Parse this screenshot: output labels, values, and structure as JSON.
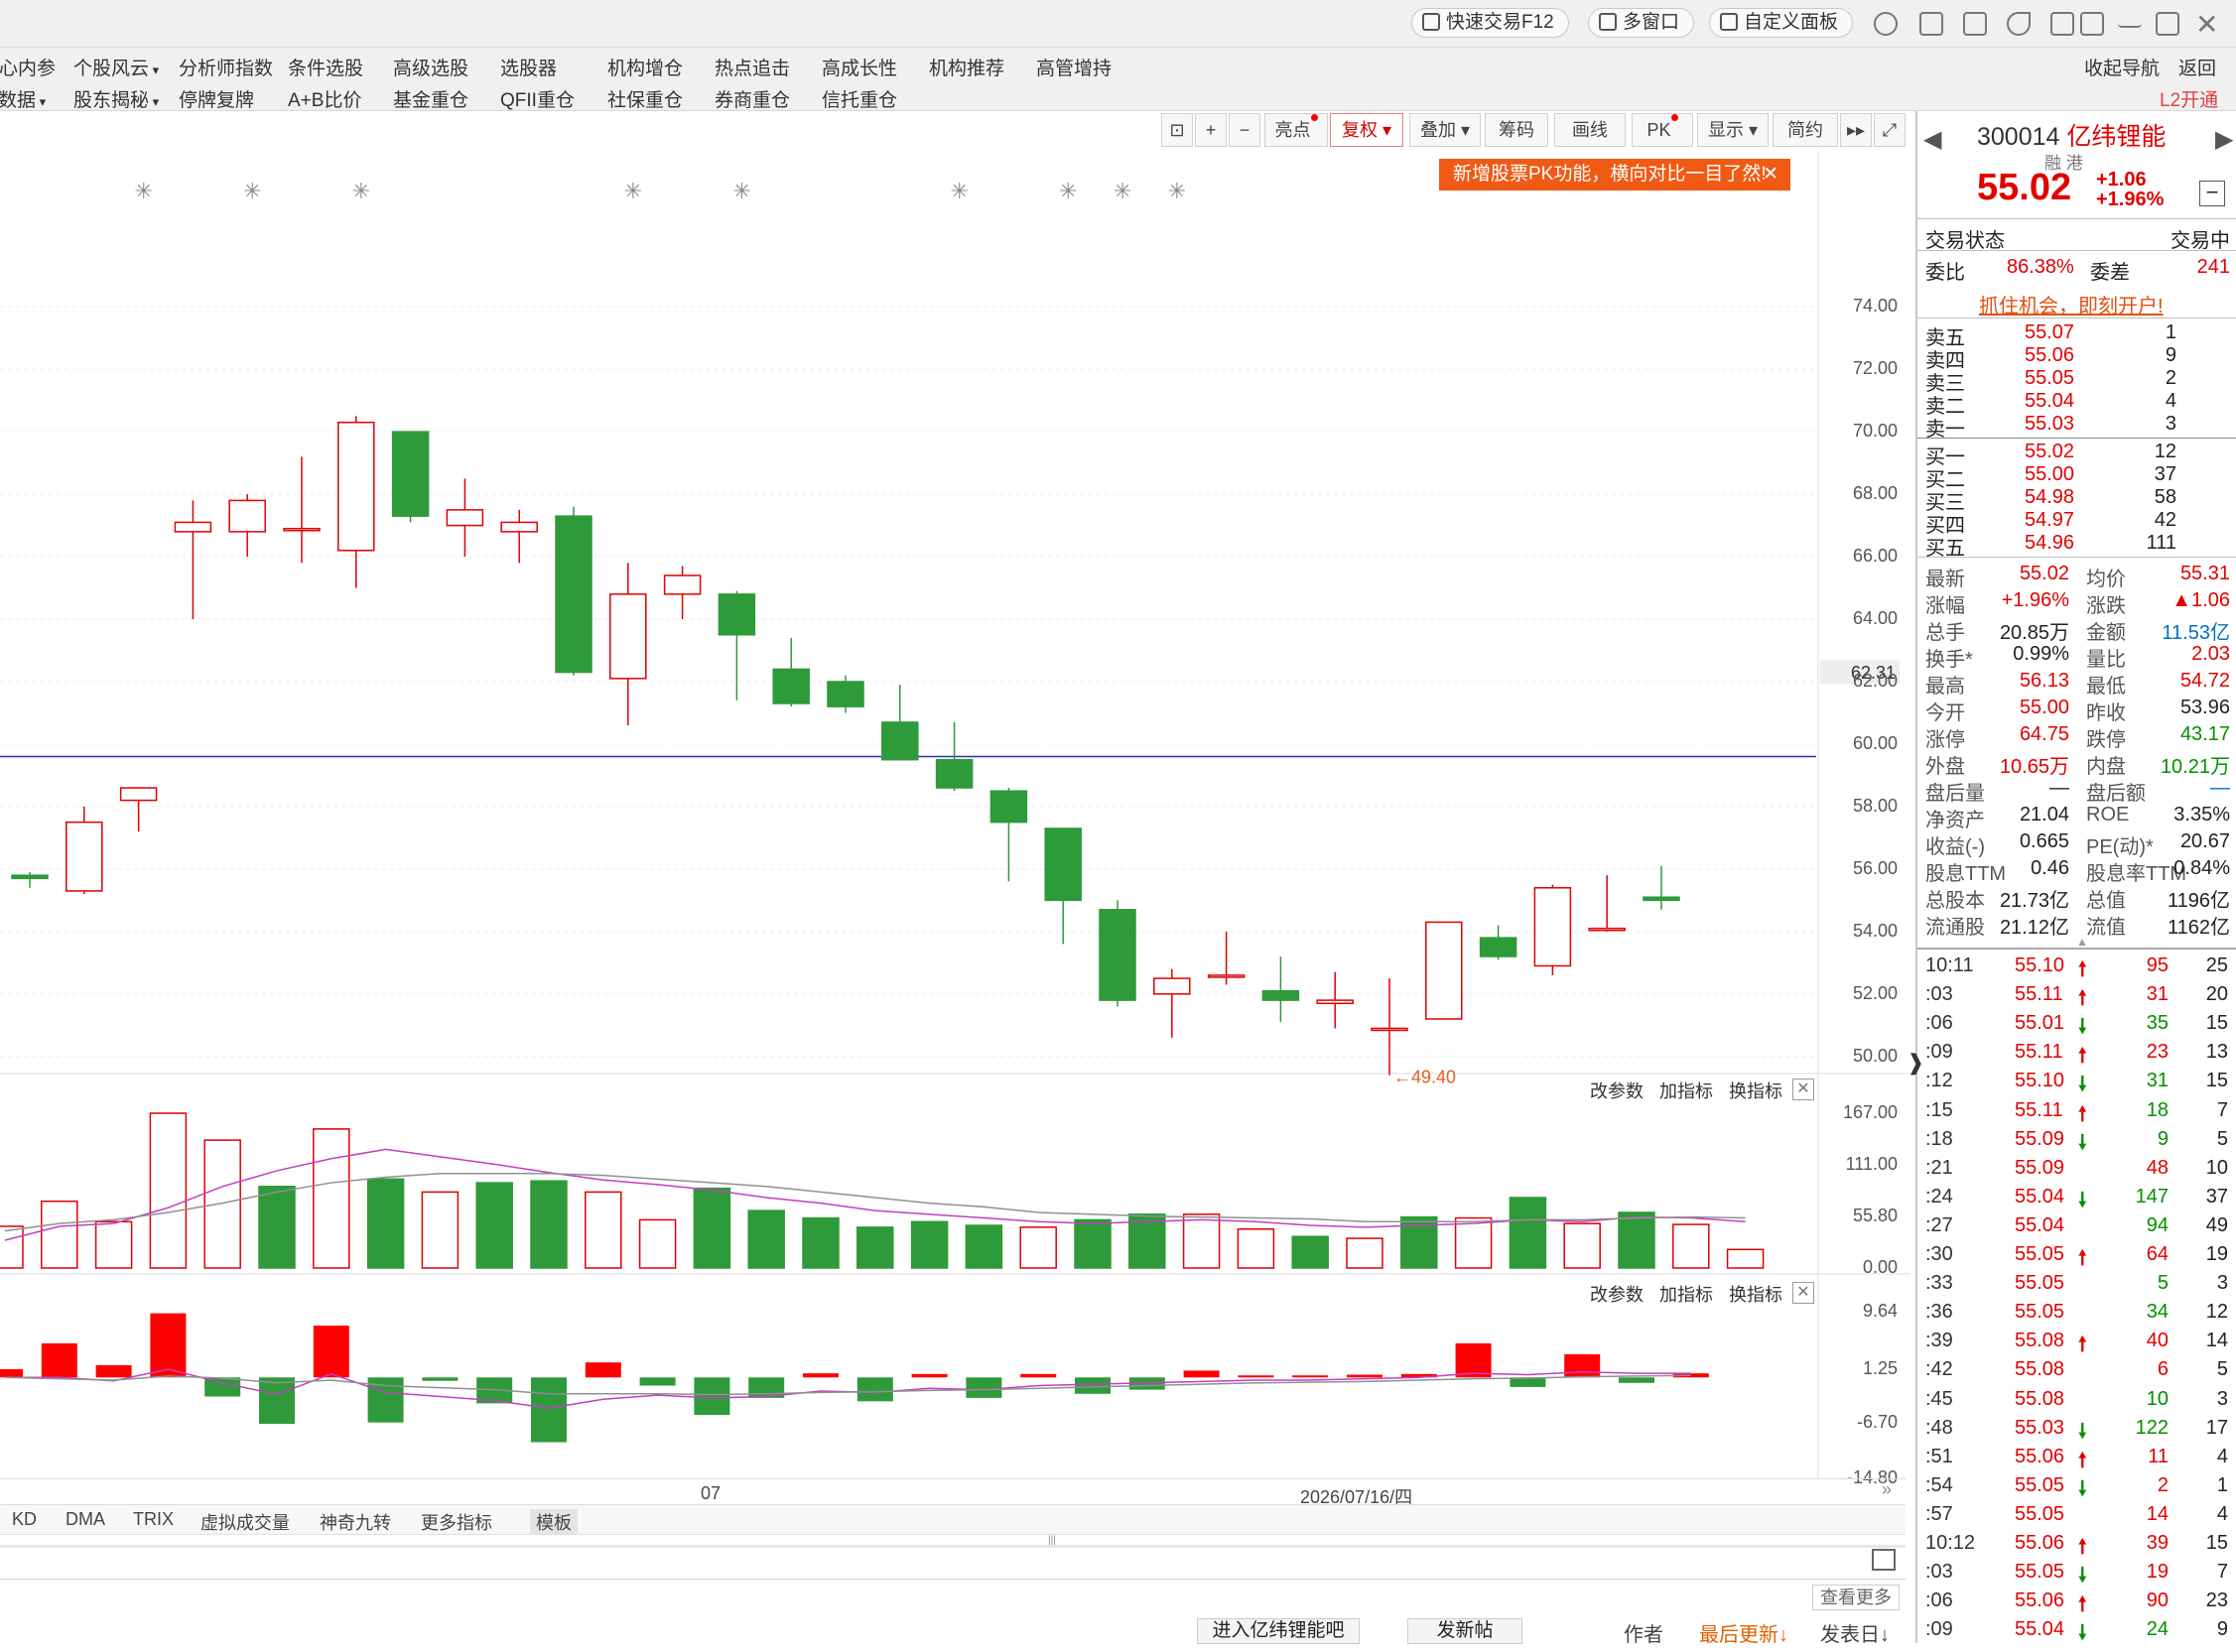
{
  "topbar": {
    "quick_trade": "快速交易F12",
    "multi_window": "多窗口",
    "custom_panel": "自定义面板",
    "icons": [
      "user-icon",
      "mail-icon",
      "home-icon",
      "back-icon",
      "shirt-icon",
      "layout-icon",
      "minimize-icon",
      "restore-icon",
      "close-icon"
    ]
  },
  "menu": {
    "row1": [
      "核心内参",
      "个股风云",
      "分析师指数",
      "条件选股",
      "高级选股",
      "选股器",
      "机构增仓",
      "热点追击",
      "高成长性",
      "机构推荐",
      "高管增持"
    ],
    "row2": [
      "数据",
      "股东揭秘",
      "停牌复牌",
      "A+B比价",
      "基金重仓",
      "QFII重仓",
      "社保重仓",
      "券商重仓",
      "信托重仓"
    ],
    "right": [
      "收起导航",
      "返回"
    ],
    "l2": "L2开通"
  },
  "chart_toolbar": {
    "buttons": [
      "亮点",
      "复权",
      "叠加",
      "筹码",
      "画线",
      "PK",
      "显示",
      "简约"
    ],
    "pk_tip": "新增股票PK功能，横向对比一目了然!"
  },
  "pane_tools": {
    "params": "改参数",
    "add": "加指标",
    "swap": "换指标"
  },
  "chart_data": [
    {
      "type": "candlestick",
      "title": "",
      "y_ticks": [
        "74.00",
        "72.00",
        "70.00",
        "68.00",
        "66.00",
        "64.00",
        "62.00",
        "60.00",
        "58.00",
        "56.00",
        "54.00",
        "52.00",
        "50.00"
      ],
      "ylim": [
        48.5,
        75.5
      ],
      "current_price_marker": "62.31",
      "horizontal_line": 59.6,
      "low_annotation": "←49.40",
      "candles": [
        {
          "o": 55.8,
          "h": 55.9,
          "l": 55.4,
          "c": 55.7
        },
        {
          "o": 55.3,
          "h": 58.0,
          "l": 55.2,
          "c": 57.5
        },
        {
          "o": 58.2,
          "h": 58.5,
          "l": 57.2,
          "c": 58.6
        },
        {
          "o": 66.8,
          "h": 67.8,
          "l": 64.0,
          "c": 67.1
        },
        {
          "o": 66.8,
          "h": 68.0,
          "l": 66.0,
          "c": 67.8
        },
        {
          "o": 66.9,
          "h": 69.2,
          "l": 65.8,
          "c": 66.9
        },
        {
          "o": 66.2,
          "h": 70.5,
          "l": 65.0,
          "c": 70.3
        },
        {
          "o": 70.0,
          "h": 70.0,
          "l": 67.1,
          "c": 67.3
        },
        {
          "o": 67.0,
          "h": 68.5,
          "l": 66.0,
          "c": 67.5
        },
        {
          "o": 66.8,
          "h": 67.5,
          "l": 65.8,
          "c": 67.1
        },
        {
          "o": 67.3,
          "h": 67.6,
          "l": 62.2,
          "c": 62.3
        },
        {
          "o": 62.1,
          "h": 65.8,
          "l": 60.6,
          "c": 64.8
        },
        {
          "o": 64.8,
          "h": 65.7,
          "l": 64.0,
          "c": 65.4
        },
        {
          "o": 64.8,
          "h": 64.9,
          "l": 61.4,
          "c": 63.5
        },
        {
          "o": 62.4,
          "h": 63.4,
          "l": 61.2,
          "c": 61.3
        },
        {
          "o": 62.0,
          "h": 62.2,
          "l": 61.0,
          "c": 61.2
        },
        {
          "o": 60.7,
          "h": 61.9,
          "l": 59.6,
          "c": 59.5
        },
        {
          "o": 59.5,
          "h": 60.7,
          "l": 58.5,
          "c": 58.6
        },
        {
          "o": 58.5,
          "h": 58.6,
          "l": 55.6,
          "c": 57.5
        },
        {
          "o": 57.3,
          "h": 57.3,
          "l": 53.6,
          "c": 55.0
        },
        {
          "o": 54.7,
          "h": 55.0,
          "l": 51.6,
          "c": 51.8
        },
        {
          "o": 52.0,
          "h": 52.8,
          "l": 50.6,
          "c": 52.5
        },
        {
          "o": 52.6,
          "h": 54.0,
          "l": 52.3,
          "c": 52.6
        },
        {
          "o": 52.1,
          "h": 53.2,
          "l": 51.1,
          "c": 51.8
        },
        {
          "o": 51.7,
          "h": 52.7,
          "l": 50.9,
          "c": 51.8
        },
        {
          "o": 50.9,
          "h": 52.5,
          "l": 49.4,
          "c": 50.9
        },
        {
          "o": 51.2,
          "h": 54.3,
          "l": 51.2,
          "c": 54.3
        },
        {
          "o": 53.8,
          "h": 54.2,
          "l": 53.1,
          "c": 53.2
        },
        {
          "o": 52.9,
          "h": 55.5,
          "l": 52.6,
          "c": 55.4
        },
        {
          "o": 54.1,
          "h": 55.8,
          "l": 54.0,
          "c": 54.1
        },
        {
          "o": 55.1,
          "h": 56.1,
          "l": 54.7,
          "c": 55.0
        }
      ],
      "markers": [
        1,
        3,
        5,
        10,
        12,
        16,
        18,
        19,
        20
      ]
    },
    {
      "type": "bar",
      "title": "",
      "y_ticks": [
        "167.00",
        "111.00",
        "55.80",
        "0.00"
      ],
      "ylim": [
        0,
        167
      ],
      "values": [
        45,
        72,
        50,
        167,
        138,
        88,
        150,
        96,
        82,
        92,
        94,
        82,
        52,
        86,
        62,
        54,
        44,
        50,
        46,
        44,
        52,
        58,
        58,
        42,
        34,
        32,
        55,
        54,
        76,
        48,
        60,
        47,
        20
      ],
      "up": [
        true,
        true,
        true,
        true,
        true,
        false,
        true,
        false,
        true,
        false,
        false,
        true,
        true,
        false,
        false,
        false,
        false,
        false,
        false,
        true,
        false,
        false,
        true,
        true,
        false,
        true,
        false,
        true,
        false,
        true,
        false,
        true
      ],
      "ma1": [
        30,
        45,
        48,
        65,
        88,
        105,
        118,
        128,
        120,
        112,
        103,
        95,
        90,
        84,
        76,
        70,
        62,
        58,
        54,
        50,
        48,
        50,
        52,
        50,
        46,
        44,
        46,
        48,
        52,
        50,
        55,
        54,
        50
      ],
      "ma2": [
        40,
        48,
        52,
        60,
        70,
        82,
        92,
        98,
        102,
        102,
        102,
        100,
        96,
        92,
        88,
        82,
        76,
        70,
        66,
        60,
        58,
        56,
        55,
        54,
        53,
        50,
        50,
        50,
        52,
        52,
        54,
        55,
        54
      ]
    },
    {
      "type": "bar",
      "title": "",
      "y_ticks": [
        "9.64",
        "1.25",
        "-6.70",
        "-14.80"
      ],
      "ylim": [
        -14.8,
        9.64
      ],
      "values": [
        1.2,
        5.0,
        1.8,
        9.4,
        -2.8,
        -6.8,
        7.6,
        -6.6,
        -0.5,
        -3.8,
        -9.5,
        2.2,
        -1.2,
        -5.5,
        -3.0,
        0.6,
        -3.5,
        0.5,
        -3.0,
        0.5,
        -2.4,
        -1.8,
        1.0,
        0.3,
        0.3,
        0.4,
        0.5,
        5.0,
        -1.4,
        3.4,
        -0.8,
        0.6
      ],
      "line1": [
        0,
        0,
        -0.5,
        1.2,
        -0.8,
        -2.5,
        0.5,
        -2.2,
        -2.8,
        -3.4,
        -4.5,
        -3.2,
        -2.6,
        -3.0,
        -2.8,
        -2.0,
        -2.2,
        -1.6,
        -1.8,
        -1.2,
        -1.0,
        -0.8,
        -0.6,
        -0.4,
        -0.4,
        -0.2,
        0,
        0.6,
        0.4,
        0.8,
        0.6,
        0.6
      ],
      "line2": [
        0,
        -0.2,
        -0.4,
        0.2,
        -0.1,
        -0.8,
        -0.4,
        -1.2,
        -1.5,
        -1.8,
        -2.4,
        -2.4,
        -2.4,
        -2.5,
        -2.4,
        -2.2,
        -2.1,
        -1.9,
        -1.8,
        -1.6,
        -1.4,
        -1.2,
        -1.0,
        -0.8,
        -0.7,
        -0.6,
        -0.4,
        -0.2,
        -0.1,
        0.1,
        0.2,
        0.3
      ]
    }
  ],
  "x_axis": {
    "labels": [
      "07",
      "2026/07/16/四"
    ]
  },
  "bottom_tabs": [
    "KD",
    "DMA",
    "TRIX",
    "虚拟成交量",
    "神奇九转",
    "更多指标",
    "模板"
  ],
  "footer": {
    "view_more": "查看更多",
    "forum": "进入亿纬锂能吧",
    "post": "发新帖",
    "author": "作者",
    "last_update": "最后更新↓",
    "post_date": "发表日↓"
  },
  "quote": {
    "code": "300014",
    "name": "亿纬锂能",
    "tags": "融 港",
    "price": "55.02",
    "change": "+1.06",
    "change_pct": "+1.96%",
    "status_label": "交易状态",
    "status_value": "交易中",
    "wb_label": "委比",
    "wb_value": "86.38%",
    "wc_label": "委差",
    "wc_value": "241",
    "promo": "抓住机会，即刻开户!",
    "asks": [
      {
        "label": "卖五",
        "price": "55.07",
        "vol": "1"
      },
      {
        "label": "卖四",
        "price": "55.06",
        "vol": "9"
      },
      {
        "label": "卖三",
        "price": "55.05",
        "vol": "2"
      },
      {
        "label": "卖二",
        "price": "55.04",
        "vol": "4"
      },
      {
        "label": "卖一",
        "price": "55.03",
        "vol": "3"
      }
    ],
    "bids": [
      {
        "label": "买一",
        "price": "55.02",
        "vol": "12"
      },
      {
        "label": "买二",
        "price": "55.00",
        "vol": "37"
      },
      {
        "label": "买三",
        "price": "54.98",
        "vol": "58"
      },
      {
        "label": "买四",
        "price": "54.97",
        "vol": "42"
      },
      {
        "label": "买五",
        "price": "54.96",
        "vol": "111"
      }
    ],
    "stats": [
      {
        "l1": "最新",
        "v1": "55.02",
        "c1": "red",
        "l2": "均价",
        "v2": "55.31",
        "c2": "red"
      },
      {
        "l1": "涨幅",
        "v1": "+1.96%",
        "c1": "red",
        "l2": "涨跌",
        "v2": "▲1.06",
        "c2": "red"
      },
      {
        "l1": "总手",
        "v1": "20.85万",
        "c1": "dark",
        "l2": "金额",
        "v2": "11.53亿",
        "c2": "blu"
      },
      {
        "l1": "换手*",
        "v1": "0.99%",
        "c1": "dark",
        "l2": "量比",
        "v2": "2.03",
        "c2": "red"
      },
      {
        "l1": "最高",
        "v1": "56.13",
        "c1": "red",
        "l2": "最低",
        "v2": "54.72",
        "c2": "red"
      },
      {
        "l1": "今开",
        "v1": "55.00",
        "c1": "red",
        "l2": "昨收",
        "v2": "53.96",
        "c2": "dark"
      },
      {
        "l1": "涨停",
        "v1": "64.75",
        "c1": "red",
        "l2": "跌停",
        "v2": "43.17",
        "c2": "grn"
      },
      {
        "l1": "外盘",
        "v1": "10.65万",
        "c1": "red",
        "l2": "内盘",
        "v2": "10.21万",
        "c2": "grn"
      },
      {
        "l1": "盘后量",
        "v1": "—",
        "c1": "dark",
        "l2": "盘后额",
        "v2": "—",
        "c2": "blu"
      },
      {
        "l1": "净资产",
        "v1": "21.04",
        "c1": "dark",
        "l2": "ROE",
        "v2": "3.35%",
        "c2": "dark"
      },
      {
        "l1": "收益(-)",
        "v1": "0.665",
        "c1": "dark",
        "l2": "PE(动)*",
        "v2": "20.67",
        "c2": "dark"
      },
      {
        "l1": "股息TTM",
        "v1": "0.46",
        "c1": "dark",
        "l2": "股息率TTM",
        "v2": "0.84%",
        "c2": "dark"
      },
      {
        "l1": "总股本",
        "v1": "21.73亿",
        "c1": "dark",
        "l2": "总值",
        "v2": "1196亿",
        "c2": "dark"
      },
      {
        "l1": "流通股",
        "v1": "21.12亿",
        "c1": "dark",
        "l2": "流值",
        "v2": "1162亿",
        "c2": "dark"
      }
    ],
    "ticks": [
      {
        "t": "10:11",
        "p": "55.10",
        "a": "up",
        "v": "95",
        "n": "25",
        "vc": "red"
      },
      {
        "t": ":03",
        "p": "55.11",
        "a": "up",
        "v": "31",
        "n": "20",
        "vc": "red"
      },
      {
        "t": ":06",
        "p": "55.01",
        "a": "down",
        "v": "35",
        "n": "15",
        "vc": "grn"
      },
      {
        "t": ":09",
        "p": "55.11",
        "a": "up",
        "v": "23",
        "n": "13",
        "vc": "red"
      },
      {
        "t": ":12",
        "p": "55.10",
        "a": "down",
        "v": "31",
        "n": "15",
        "vc": "grn"
      },
      {
        "t": ":15",
        "p": "55.11",
        "a": "up",
        "v": "18",
        "n": "7",
        "vc": "grn"
      },
      {
        "t": ":18",
        "p": "55.09",
        "a": "down",
        "v": "9",
        "n": "5",
        "vc": "grn"
      },
      {
        "t": ":21",
        "p": "55.09",
        "a": "",
        "v": "48",
        "n": "10",
        "vc": "red"
      },
      {
        "t": ":24",
        "p": "55.04",
        "a": "down",
        "v": "147",
        "n": "37",
        "vc": "grn"
      },
      {
        "t": ":27",
        "p": "55.04",
        "a": "",
        "v": "94",
        "n": "49",
        "vc": "grn"
      },
      {
        "t": ":30",
        "p": "55.05",
        "a": "up",
        "v": "64",
        "n": "19",
        "vc": "red"
      },
      {
        "t": ":33",
        "p": "55.05",
        "a": "",
        "v": "5",
        "n": "3",
        "vc": "grn"
      },
      {
        "t": ":36",
        "p": "55.05",
        "a": "",
        "v": "34",
        "n": "12",
        "vc": "grn"
      },
      {
        "t": ":39",
        "p": "55.08",
        "a": "up",
        "v": "40",
        "n": "14",
        "vc": "red"
      },
      {
        "t": ":42",
        "p": "55.08",
        "a": "",
        "v": "6",
        "n": "5",
        "vc": "red"
      },
      {
        "t": ":45",
        "p": "55.08",
        "a": "",
        "v": "10",
        "n": "3",
        "vc": "grn"
      },
      {
        "t": ":48",
        "p": "55.03",
        "a": "down",
        "v": "122",
        "n": "17",
        "vc": "grn"
      },
      {
        "t": ":51",
        "p": "55.06",
        "a": "up",
        "v": "11",
        "n": "4",
        "vc": "red"
      },
      {
        "t": ":54",
        "p": "55.05",
        "a": "down",
        "v": "2",
        "n": "1",
        "vc": "red"
      },
      {
        "t": ":57",
        "p": "55.05",
        "a": "",
        "v": "14",
        "n": "4",
        "vc": "red"
      },
      {
        "t": "10:12",
        "p": "55.06",
        "a": "up",
        "v": "39",
        "n": "15",
        "vc": "red"
      },
      {
        "t": ":03",
        "p": "55.05",
        "a": "down",
        "v": "19",
        "n": "7",
        "vc": "red"
      },
      {
        "t": ":06",
        "p": "55.06",
        "a": "up",
        "v": "90",
        "n": "23",
        "vc": "red"
      },
      {
        "t": ":09",
        "p": "55.04",
        "a": "down",
        "v": "24",
        "n": "9",
        "vc": "grn"
      }
    ]
  },
  "colors": {
    "up": "#e00000",
    "down": "#2e9a3a",
    "ma_magenta": "#c040c0",
    "ma_gray": "#909090",
    "hline": "#3030a0",
    "accent": "#f05a14"
  }
}
